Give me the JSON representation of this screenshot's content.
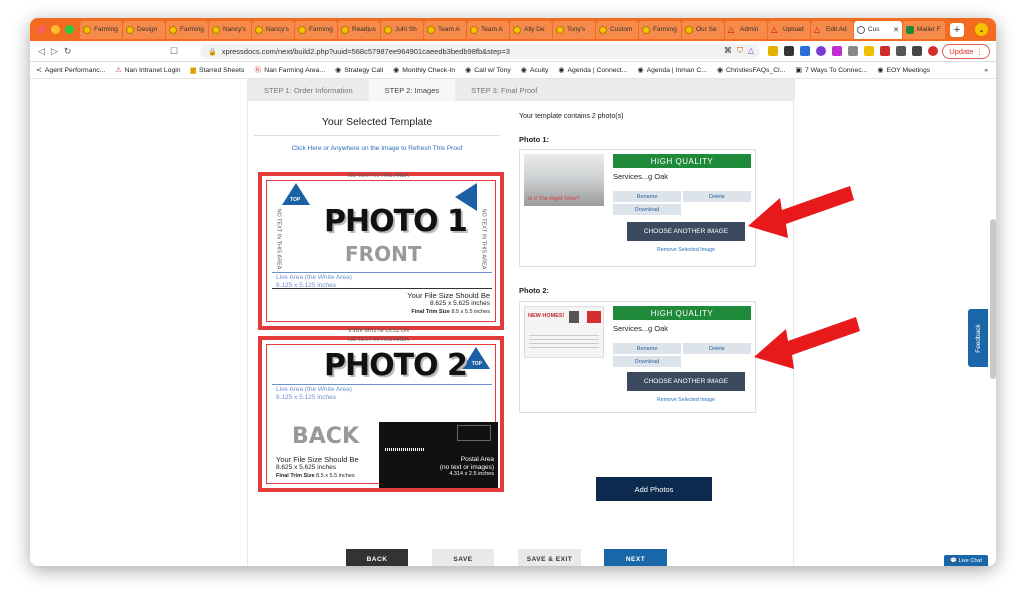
{
  "browser": {
    "tabs": [
      {
        "label": "Farming"
      },
      {
        "label": "Design"
      },
      {
        "label": "Farming"
      },
      {
        "label": "Nancy's"
      },
      {
        "label": "Nancy's"
      },
      {
        "label": "Farming"
      },
      {
        "label": "Readjus"
      },
      {
        "label": "Juhi Sh"
      },
      {
        "label": "Team A"
      },
      {
        "label": "Team A"
      },
      {
        "label": "Ally De"
      },
      {
        "label": "Tony's"
      },
      {
        "label": "Custom"
      },
      {
        "label": "Farming"
      },
      {
        "label": "Our Se"
      },
      {
        "label": "Admin"
      },
      {
        "label": "Upload"
      },
      {
        "label": "Edit Ad"
      },
      {
        "label": "Cus"
      },
      {
        "label": "Mailer F"
      }
    ],
    "url": "xpressdocs.com/next/build2.php?uuid=568c57987ee964901caeedb3bedb98fb&step=3",
    "update_label": "Update",
    "bookmarks": [
      {
        "label": "Agent Performanc..."
      },
      {
        "label": "Nan Intranet Login"
      },
      {
        "label": "Starred Sheets"
      },
      {
        "label": "Nan Farming Area..."
      },
      {
        "label": "Strategy Call"
      },
      {
        "label": "Monthly Check-In"
      },
      {
        "label": "Call w/ Tony"
      },
      {
        "label": "Acuity"
      },
      {
        "label": "Agenda | Connect..."
      },
      {
        "label": "Agenda | Inman C..."
      },
      {
        "label": "ChristiesFAQs_Cl..."
      },
      {
        "label": "7 Ways To Connec..."
      },
      {
        "label": "EOY Meetings"
      }
    ]
  },
  "steps": {
    "step1": "STEP 1: Order Information",
    "step2": "STEP 2: Images",
    "step3": "STEP 3: Final Proof"
  },
  "template": {
    "heading": "Your Selected Template",
    "refresh_link": "Click Here or Anywhere on the Image to Refresh This Proof",
    "front": {
      "no_text": "NO TEXT IN THIS AREA",
      "photo_label": "PHOTO 1",
      "side_label": "FRONT",
      "live_area": "Live Area (the White Area)",
      "live_size": "8.125 x 5.125 inches",
      "file_size_label": "Your File Size Should Be",
      "file_size": "8.625 x 5.625 inches",
      "trim_label": "Final Trim Size",
      "trim_size": "8.5 x 5.5 inches",
      "logo_text": "TOP"
    },
    "back": {
      "no_text": "NO TEXT IN THIS AREA",
      "photo_label": "PHOTO 2",
      "side_label": "BACK",
      "live_area": "Live Area (the White Area)",
      "live_size": "8.125 x 5.125 inches",
      "file_size_label": "Your File Size Should Be",
      "file_size": "8.625 x 5.625 inches",
      "trim_label": "Final Trim Size",
      "trim_size": "8.5 x 5.5 inches",
      "postal_label": "Postal Area",
      "postal_note": "(no text or images)",
      "postal_size": "4.314 x 2.5 inches",
      "logo_text": "TOP"
    }
  },
  "photos": {
    "summary": "Your template contains 2 photo(s)",
    "items": [
      {
        "heading": "Photo 1:",
        "quality": "HIGH QUALITY",
        "name": "Services...g Oak",
        "thumb_caption": "Is It The Right Time?",
        "rename": "Rename",
        "delete": "Delete",
        "download": "Download",
        "choose": "CHOOSE ANOTHER IMAGE",
        "remove": "Remove Selected Image"
      },
      {
        "heading": "Photo 2:",
        "quality": "HIGH QUALITY",
        "name": "Services...g Oak",
        "thumb_caption": "NEW HOMES!",
        "rename": "Rename",
        "delete": "Delete",
        "download": "Download",
        "choose": "CHOOSE ANOTHER IMAGE",
        "remove": "Remove Selected Image"
      }
    ],
    "add_photos": "Add Photos"
  },
  "footer": {
    "back": "BACK",
    "save": "SAVE",
    "save_exit": "SAVE & EXIT",
    "next": "NEXT"
  },
  "feedback": "Feedback",
  "live_chat": "Live Chat",
  "colors": {
    "tab_bar": "#f26b21",
    "proof_border": "#e23b3b",
    "high_quality": "#1e8a3a",
    "choose_btn": "#3b4a5e",
    "add_photos": "#0c2a4e",
    "next_btn": "#1966a8",
    "arrow": "#e8191a"
  }
}
